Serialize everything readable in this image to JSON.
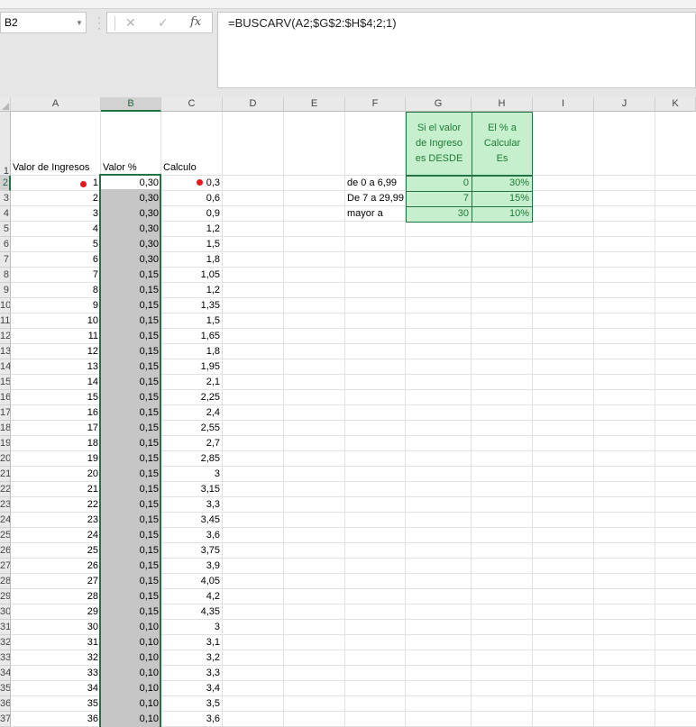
{
  "formula_bar": {
    "name_box": "B2",
    "cancel_glyph": "✕",
    "enter_glyph": "✓",
    "fx_label": "fx",
    "formula": "=BUSCARV(A2;$G$2:$H$4;2;1)"
  },
  "columns": [
    "A",
    "B",
    "C",
    "D",
    "E",
    "F",
    "G",
    "H",
    "I",
    "J",
    "K"
  ],
  "row_headers": [
    "1",
    "2",
    "3",
    "4",
    "5",
    "6",
    "7",
    "8",
    "9",
    "10",
    "11",
    "12",
    "13",
    "14",
    "15",
    "16",
    "17",
    "18",
    "19",
    "20",
    "21",
    "22",
    "23",
    "24",
    "25",
    "26",
    "27",
    "28",
    "29",
    "30",
    "31",
    "32",
    "33",
    "34",
    "35",
    "36",
    "37"
  ],
  "headers": {
    "a1": "Valor de Ingresos",
    "b1": "Valor %",
    "c1": "Calculo",
    "g1": "Si el valor de Ingreso es DESDE",
    "h1": "El % a Calcular Es"
  },
  "lookup_table": [
    {
      "label": "de 0 a 6,99",
      "desde": "0",
      "pct": "30%"
    },
    {
      "label": "De 7 a 29,99",
      "desde": "7",
      "pct": "15%"
    },
    {
      "label": "mayor a",
      "desde": "30",
      "pct": "10%"
    }
  ],
  "rows": [
    {
      "a": "1",
      "b": "0,30",
      "c": "0,3"
    },
    {
      "a": "2",
      "b": "0,30",
      "c": "0,6"
    },
    {
      "a": "3",
      "b": "0,30",
      "c": "0,9"
    },
    {
      "a": "4",
      "b": "0,30",
      "c": "1,2"
    },
    {
      "a": "5",
      "b": "0,30",
      "c": "1,5"
    },
    {
      "a": "6",
      "b": "0,30",
      "c": "1,8"
    },
    {
      "a": "7",
      "b": "0,15",
      "c": "1,05"
    },
    {
      "a": "8",
      "b": "0,15",
      "c": "1,2"
    },
    {
      "a": "9",
      "b": "0,15",
      "c": "1,35"
    },
    {
      "a": "10",
      "b": "0,15",
      "c": "1,5"
    },
    {
      "a": "11",
      "b": "0,15",
      "c": "1,65"
    },
    {
      "a": "12",
      "b": "0,15",
      "c": "1,8"
    },
    {
      "a": "13",
      "b": "0,15",
      "c": "1,95"
    },
    {
      "a": "14",
      "b": "0,15",
      "c": "2,1"
    },
    {
      "a": "15",
      "b": "0,15",
      "c": "2,25"
    },
    {
      "a": "16",
      "b": "0,15",
      "c": "2,4"
    },
    {
      "a": "17",
      "b": "0,15",
      "c": "2,55"
    },
    {
      "a": "18",
      "b": "0,15",
      "c": "2,7"
    },
    {
      "a": "19",
      "b": "0,15",
      "c": "2,85"
    },
    {
      "a": "20",
      "b": "0,15",
      "c": "3"
    },
    {
      "a": "21",
      "b": "0,15",
      "c": "3,15"
    },
    {
      "a": "22",
      "b": "0,15",
      "c": "3,3"
    },
    {
      "a": "23",
      "b": "0,15",
      "c": "3,45"
    },
    {
      "a": "24",
      "b": "0,15",
      "c": "3,6"
    },
    {
      "a": "25",
      "b": "0,15",
      "c": "3,75"
    },
    {
      "a": "26",
      "b": "0,15",
      "c": "3,9"
    },
    {
      "a": "27",
      "b": "0,15",
      "c": "4,05"
    },
    {
      "a": "28",
      "b": "0,15",
      "c": "4,2"
    },
    {
      "a": "29",
      "b": "0,15",
      "c": "4,35"
    },
    {
      "a": "30",
      "b": "0,10",
      "c": "3"
    },
    {
      "a": "31",
      "b": "0,10",
      "c": "3,1"
    },
    {
      "a": "32",
      "b": "0,10",
      "c": "3,2"
    },
    {
      "a": "33",
      "b": "0,10",
      "c": "3,3"
    },
    {
      "a": "34",
      "b": "0,10",
      "c": "3,4"
    },
    {
      "a": "35",
      "b": "0,10",
      "c": "3,5"
    },
    {
      "a": "36",
      "b": "0,10",
      "c": "3,6"
    }
  ],
  "colors": {
    "accent": "#217346",
    "lookup_fill": "#c6efce",
    "lookup_text": "#1e7b34",
    "range_fill": "#c6c6c6",
    "marker": "#e8161b"
  }
}
